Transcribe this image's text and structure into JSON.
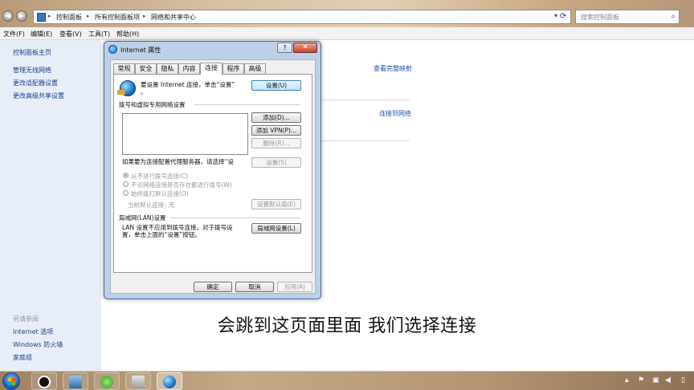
{
  "address_bar": {
    "breadcrumbs": [
      "控制面板",
      "所有控制面板项",
      "网络和共享中心"
    ],
    "search_placeholder": "搜索控制面板"
  },
  "menu": [
    "文件(F)",
    "编辑(E)",
    "查看(V)",
    "工具(T)",
    "帮助(H)"
  ],
  "sidebar": {
    "home": "控制面板主页",
    "links": [
      "管理无线网络",
      "更改适配器设置",
      "更改高级共享设置"
    ],
    "see_also_heading": "另请参阅",
    "see_also": [
      "Internet 选项",
      "Windows 防火墙",
      "家庭组"
    ]
  },
  "main": {
    "view_full_map": "查看完整映射",
    "connect_to_network": "连接到网络",
    "stray_text": "。"
  },
  "dialog": {
    "title": "Internet 属性",
    "help": "?",
    "close": "✕",
    "tabs": [
      "常规",
      "安全",
      "隐私",
      "内容",
      "连接",
      "程序",
      "高级"
    ],
    "active_tab_index": 4,
    "setup_text_line1": "要设置 Internet 连接，单击“设置”",
    "setup_text_line2": "。",
    "setup_button": "设置(U)",
    "dialup_section": "拨号和虚拟专用网络设置",
    "add_button": "添加(D)...",
    "add_vpn_button": "添加 VPN(P)...",
    "remove_button": "删除(R)...",
    "proxy_text": "如果要为连接配置代理服务器，请选择“设",
    "settings_button": "设置(S)",
    "radio_options": [
      "从不进行拨号连接(C)",
      "不论网络连接是否存在都进行拨号(W)",
      "始终拨打默认连接(O)"
    ],
    "current_default_label": "当前默认连接：",
    "current_default_value": "无",
    "set_default_button": "设置默认值(E)",
    "lan_section": "局域网(LAN)设置",
    "lan_text_line1": "LAN 设置不应用到拨号连接。对于拨号设",
    "lan_text_line2": "置，单击上面的“设置”按钮。",
    "lan_button": "局域网设置(L)",
    "ok_button": "确定",
    "cancel_button": "取消",
    "apply_button": "应用(A)"
  },
  "caption": "会跳到这页面里面 我们选择连接",
  "colors": {
    "link": "#1f4fa8",
    "sidebar_bg": "#e8eef8",
    "dialog_frame": "#bcd0e8",
    "close_button": "#c4432f"
  }
}
